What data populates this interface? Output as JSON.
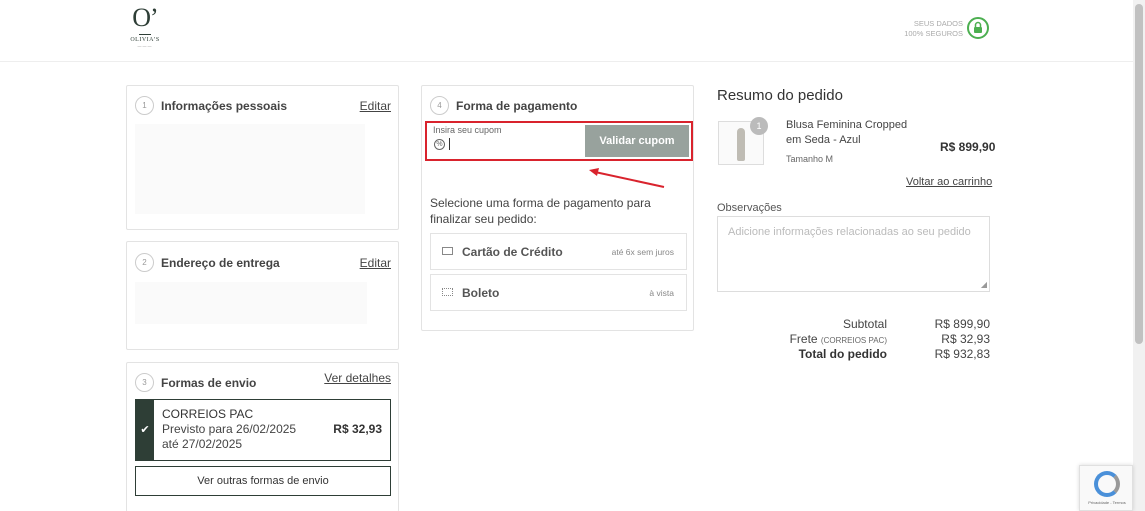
{
  "header": {
    "logo_mark": "O’",
    "logo_text": "OLIVIA’S",
    "logo_sub": "———",
    "secure_line1": "SEUS DADOS",
    "secure_line2": "100% SEGUROS"
  },
  "personal": {
    "step": "1",
    "title": "Informações pessoais",
    "edit": "Editar"
  },
  "delivery": {
    "step": "2",
    "title": "Endereço de entrega",
    "edit": "Editar"
  },
  "shipping": {
    "step": "3",
    "title": "Formas de envio",
    "details_link": "Ver detalhes",
    "option_name": "CORREIOS PAC",
    "option_date": "Previsto para 26/02/2025 até 27/02/2025",
    "option_price": "R$ 32,93",
    "other_button": "Ver outras formas de envio"
  },
  "payment": {
    "step": "4",
    "title": "Forma de pagamento",
    "coupon_label": "Insira seu cupom",
    "coupon_value": "",
    "coupon_button": "Validar cupom",
    "description": "Selecione uma forma de pagamento para finalizar seu pedido:",
    "options": [
      {
        "name": "Cartão de Crédito",
        "note": "até 6x sem juros"
      },
      {
        "name": "Boleto",
        "note": "à vista"
      }
    ]
  },
  "summary": {
    "title": "Resumo do pedido",
    "product": {
      "qty": "1",
      "name": "Blusa Feminina Cropped em Seda - Azul",
      "size": "Tamanho M",
      "price": "R$ 899,90"
    },
    "back_to_cart": "Voltar ao carrinho",
    "notes_label": "Observações",
    "notes_placeholder": "Adicione informações relacionadas ao seu pedido",
    "subtotal_label": "Subtotal",
    "subtotal_value": "R$ 899,90",
    "shipping_label": "Frete",
    "shipping_method": "(CORREIOS PAC)",
    "shipping_value": "R$ 32,93",
    "total_label": "Total do pedido",
    "total_value": "R$ 932,83"
  },
  "recaptcha": {
    "text": "Privacidade - Termos"
  },
  "colors": {
    "accent": "#2e3e36",
    "coupon_button": "#98a29d",
    "highlight": "#d9232d",
    "secure": "#4caf50"
  }
}
